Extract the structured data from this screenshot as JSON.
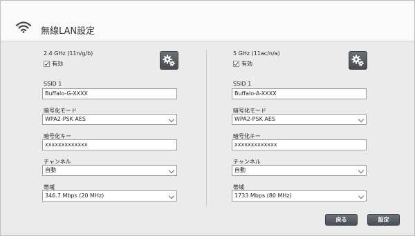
{
  "header": {
    "title": "無線LAN設定",
    "icon": "wifi-icon"
  },
  "left": {
    "band": "2.4 GHz (11n/g/b)",
    "enabled_label": "有効",
    "enabled": true,
    "ssid_label": "SSID 1",
    "ssid_value": "Buffalo-G-XXXX",
    "encryption_label": "暗号化モード",
    "encryption_value": "WPA2-PSK AES",
    "key_label": "暗号化キー",
    "key_value": "xxxxxxxxxxxxx",
    "channel_label": "チャンネル",
    "channel_value": "自動",
    "bandwidth_label": "帯域",
    "bandwidth_value": "346.7 Mbps (20 MHz)"
  },
  "right": {
    "band": "5 GHz (11ac/n/a)",
    "enabled_label": "有効",
    "enabled": true,
    "ssid_label": "SSID 1",
    "ssid_value": "Buffalo-A-XXXX",
    "encryption_label": "暗号化モード",
    "encryption_value": "WPA2-PSK AES",
    "key_label": "暗号化キー",
    "key_value": "xxxxxxxxxxxxx",
    "channel_label": "チャンネル",
    "channel_value": "自動",
    "bandwidth_label": "帯域",
    "bandwidth_value": "1733 Mbps (80 MHz)"
  },
  "footer": {
    "back_label": "戻る",
    "apply_label": "設定"
  }
}
